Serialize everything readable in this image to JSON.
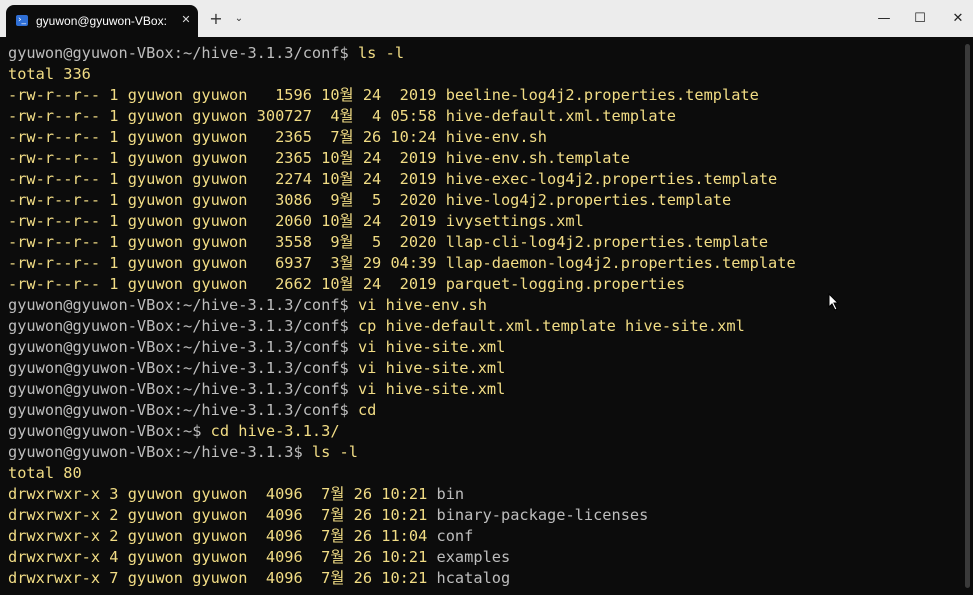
{
  "window": {
    "tab_title": "gyuwon@gyuwon-VBox: ~/h",
    "tab_close": "✕",
    "new_tab": "+",
    "dropdown": "⌄",
    "minimize": "—",
    "maximize": "☐",
    "close": "✕"
  },
  "terminal": {
    "lines": [
      {
        "prompt": "gyuwon@gyuwon-VBox:~/hive-3.1.3/conf$",
        "text": " ls -l"
      },
      {
        "text": "total 336"
      },
      {
        "text": "-rw-r--r-- 1 gyuwon gyuwon   1596 10월 24  2019 beeline-log4j2.properties.template"
      },
      {
        "text": "-rw-r--r-- 1 gyuwon gyuwon 300727  4월  4 05:58 hive-default.xml.template"
      },
      {
        "text": "-rw-r--r-- 1 gyuwon gyuwon   2365  7월 26 10:24 hive-env.sh"
      },
      {
        "text": "-rw-r--r-- 1 gyuwon gyuwon   2365 10월 24  2019 hive-env.sh.template"
      },
      {
        "text": "-rw-r--r-- 1 gyuwon gyuwon   2274 10월 24  2019 hive-exec-log4j2.properties.template"
      },
      {
        "text": "-rw-r--r-- 1 gyuwon gyuwon   3086  9월  5  2020 hive-log4j2.properties.template"
      },
      {
        "text": "-rw-r--r-- 1 gyuwon gyuwon   2060 10월 24  2019 ivysettings.xml"
      },
      {
        "text": "-rw-r--r-- 1 gyuwon gyuwon   3558  9월  5  2020 llap-cli-log4j2.properties.template"
      },
      {
        "text": "-rw-r--r-- 1 gyuwon gyuwon   6937  3월 29 04:39 llap-daemon-log4j2.properties.template"
      },
      {
        "text": "-rw-r--r-- 1 gyuwon gyuwon   2662 10월 24  2019 parquet-logging.properties"
      },
      {
        "prompt": "gyuwon@gyuwon-VBox:~/hive-3.1.3/conf$",
        "text": " vi hive-env.sh"
      },
      {
        "prompt": "gyuwon@gyuwon-VBox:~/hive-3.1.3/conf$",
        "text": " cp hive-default.xml.template hive-site.xml"
      },
      {
        "prompt": "gyuwon@gyuwon-VBox:~/hive-3.1.3/conf$",
        "text": " vi hive-site.xml"
      },
      {
        "prompt": "gyuwon@gyuwon-VBox:~/hive-3.1.3/conf$",
        "text": " vi hive-site.xml"
      },
      {
        "prompt": "gyuwon@gyuwon-VBox:~/hive-3.1.3/conf$",
        "text": " vi hive-site.xml"
      },
      {
        "prompt": "gyuwon@gyuwon-VBox:~/hive-3.1.3/conf$",
        "text": " cd"
      },
      {
        "prompt": "gyuwon@gyuwon-VBox:~$",
        "text": " cd hive-3.1.3/"
      },
      {
        "prompt": "gyuwon@gyuwon-VBox:~/hive-3.1.3$",
        "text": " ls -l"
      },
      {
        "text": "total 80"
      },
      {
        "text": "drwxrwxr-x 3 gyuwon gyuwon  4096  7월 26 10:21 ",
        "dir": "bin"
      },
      {
        "text": "drwxrwxr-x 2 gyuwon gyuwon  4096  7월 26 10:21 ",
        "dir": "binary-package-licenses"
      },
      {
        "text": "drwxrwxr-x 2 gyuwon gyuwon  4096  7월 26 11:04 ",
        "dir": "conf"
      },
      {
        "text": "drwxrwxr-x 4 gyuwon gyuwon  4096  7월 26 10:21 ",
        "dir": "examples"
      },
      {
        "text": "drwxrwxr-x 7 gyuwon gyuwon  4096  7월 26 10:21 ",
        "dir": "hcatalog"
      }
    ]
  }
}
